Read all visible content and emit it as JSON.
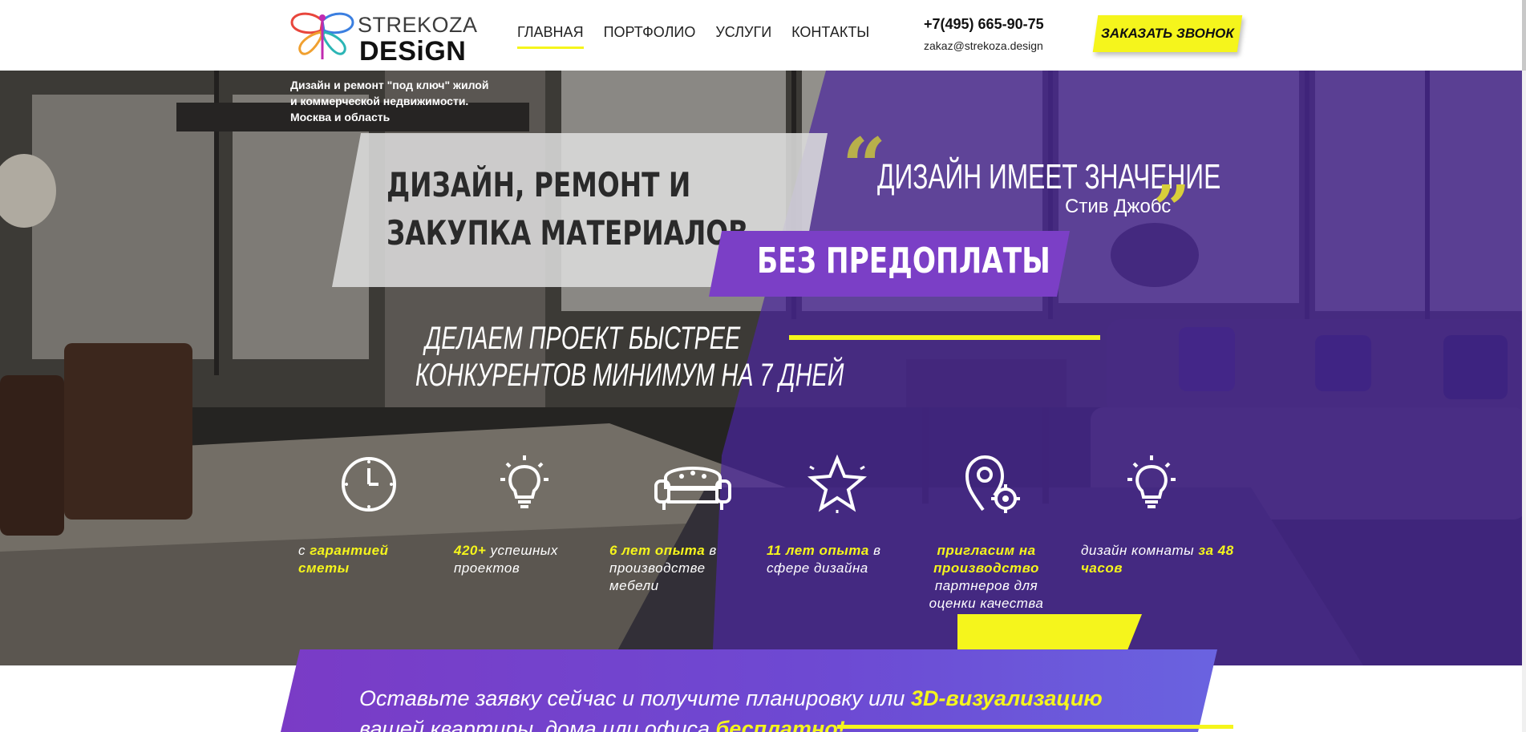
{
  "header": {
    "logo_line1": "STREKOZA",
    "logo_line2": "DESiGN",
    "nav": [
      {
        "label": "ГЛАВНАЯ",
        "active": true
      },
      {
        "label": "ПОРТФОЛИО",
        "active": false
      },
      {
        "label": "УСЛУГИ",
        "active": false
      },
      {
        "label": "КОНТАКТЫ",
        "active": false
      }
    ],
    "phone": "+7(495) 665-90-75",
    "email": "zakaz@strekoza.design",
    "call_button": "ЗАКАЗАТЬ ЗВОНОК"
  },
  "hero": {
    "subtitle": "Дизайн и ремонт \"под ключ\" жилой и коммерческой недвижимости. Москва и область",
    "title": "ДИЗАЙН, РЕМОНТ И ЗАКУПКА МАТЕРИАЛОВ",
    "quote": "ДИЗАЙН ИМЕЕТ ЗНАЧЕНИЕ",
    "quote_author": "Стив Джобс",
    "badge": "БЕЗ ПРЕДОПЛАТЫ",
    "speed_line1": "ДЕЛАЕМ ПРОЕКТ БЫСТРЕЕ",
    "speed_line2": "КОНКУРЕНТОВ МИНИМУМ НА 7 ДНЕЙ"
  },
  "features": [
    {
      "icon": "clock-icon",
      "pre": "с",
      "hl": "гарантией сметы",
      "post": ""
    },
    {
      "icon": "lightbulb-icon",
      "pre": "",
      "hl": "420+",
      "post": "успешных проектов"
    },
    {
      "icon": "sofa-icon",
      "pre": "",
      "hl": "6 лет опыта",
      "post": "в производстве мебели"
    },
    {
      "icon": "star-icon",
      "pre": "",
      "hl": "11 лет опыта",
      "post": "в сфере дизайна"
    },
    {
      "icon": "location-gear-icon",
      "pre": "",
      "hl": "пригласим на производство",
      "post": "партнеров для оценки качества"
    },
    {
      "icon": "lightbulb-icon",
      "pre": "дизайн комнаты",
      "hl": "за 48 часов",
      "post": ""
    }
  ],
  "cta": {
    "part1": "Оставьте заявку сейчас и получите планировку или",
    "hl1": "3D-визуализацию",
    "part2": "вашей квартиры, дома или офиса",
    "hl2": "бесплатно!"
  },
  "colors": {
    "accent_yellow": "#f5f51c",
    "brand_purple": "#7b3fc6"
  }
}
